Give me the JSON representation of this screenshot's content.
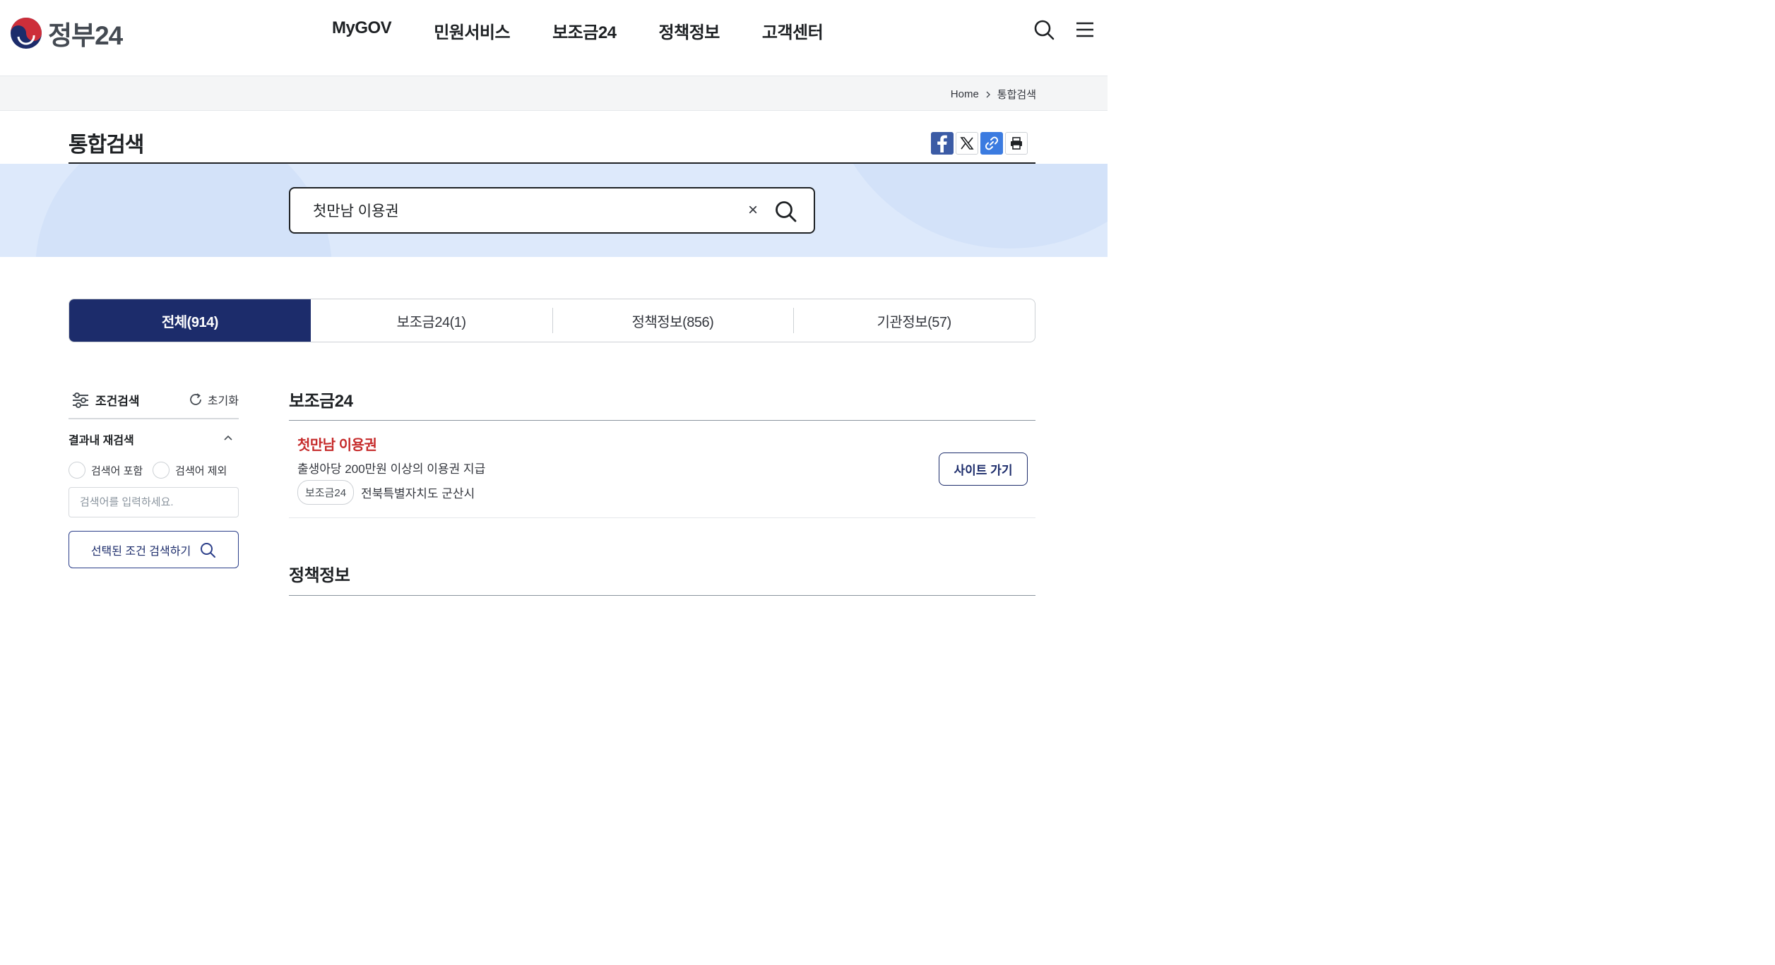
{
  "header": {
    "logo_text": "정부24",
    "nav": [
      "MyGOV",
      "민원서비스",
      "보조금24",
      "정책정보",
      "고객센터"
    ]
  },
  "breadcrumb": {
    "home": "Home",
    "current": "통합검색"
  },
  "page": {
    "title": "통합검색"
  },
  "search": {
    "value": "첫만남 이용권",
    "clear": "×"
  },
  "tabs": [
    {
      "label": "전체(914)",
      "active": true
    },
    {
      "label": "보조금24(1)",
      "active": false
    },
    {
      "label": "정책정보(856)",
      "active": false
    },
    {
      "label": "기관정보(57)",
      "active": false
    }
  ],
  "filter": {
    "title": "조건검색",
    "reset": "초기화",
    "refine_label": "결과내 재검색",
    "radio_include": "검색어 포함",
    "radio_exclude": "검색어 제외",
    "input_placeholder": "검색어를 입력하세요.",
    "button": "선택된 조건 검색하기"
  },
  "results": {
    "subsidy_section": "보조금24",
    "item": {
      "title": "첫만남 이용권",
      "desc": "출생아당 200만원 이상의 이용권 지급",
      "tag": "보조금24",
      "region": "전북특별자치도 군산시",
      "button": "사이트 가기"
    },
    "policy_section": "정책정보"
  },
  "colors": {
    "primary_navy": "#1c2c6b",
    "highlight_red": "#c62b2b",
    "search_band": "#dde9fb"
  }
}
